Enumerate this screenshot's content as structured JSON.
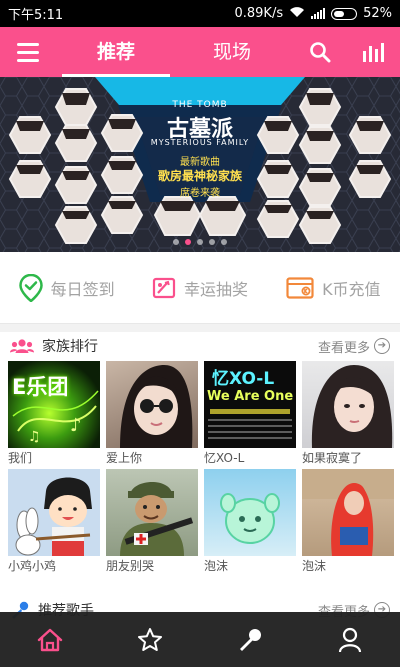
{
  "status_bar": {
    "time": "下午5:11",
    "speed": "0.89K/s",
    "battery": "52%",
    "battery_level": 0.52
  },
  "header": {
    "tabs": [
      {
        "label": "推荐",
        "active": true
      },
      {
        "label": "现场",
        "active": false
      }
    ],
    "icons": [
      "menu-icon",
      "search-icon",
      "chart-bars-icon"
    ],
    "color": "#fa508c"
  },
  "banner": {
    "top_line": "THE TOMB",
    "title": "古墓派",
    "subtitle": "MYSTERIOUS FAMILY",
    "new_song": "最新歌曲",
    "slogan_line1": "歌房最神秘家族",
    "slogan_line2": "席卷来袭",
    "slide_count": 5,
    "active_slide": 1
  },
  "quick_actions": [
    {
      "label": "每日签到",
      "icon": "checkin-pin-icon",
      "color": "#2eb84a"
    },
    {
      "label": "幸运抽奖",
      "icon": "lottery-icon",
      "color": "#fa508c"
    },
    {
      "label": "K币充值",
      "icon": "card-icon",
      "color": "#f2883a"
    }
  ],
  "family_section": {
    "title": "家族排行",
    "more": "查看更多",
    "icon": "group-icon",
    "items": [
      {
        "name": "我们",
        "art": "E乐团"
      },
      {
        "name": "爱上你",
        "art": ""
      },
      {
        "name": "忆XO-L",
        "art": "忆XO-L",
        "art_sub": "We Are One"
      },
      {
        "name": "如果寂寞了",
        "art": ""
      },
      {
        "name": "小鸡小鸡",
        "art": ""
      },
      {
        "name": "朋友别哭",
        "art": ""
      },
      {
        "name": "泡沫",
        "art": ""
      },
      {
        "name": "泡沫",
        "art": ""
      }
    ]
  },
  "singer_section": {
    "title": "推荐歌手",
    "more": "查看更多",
    "icon": "microphone-icon"
  },
  "bottom_nav": [
    {
      "name": "home",
      "icon": "home-icon",
      "active": true
    },
    {
      "name": "star",
      "icon": "star-icon",
      "active": false
    },
    {
      "name": "sing",
      "icon": "microphone-icon",
      "active": false
    },
    {
      "name": "profile",
      "icon": "user-icon",
      "active": false
    }
  ]
}
